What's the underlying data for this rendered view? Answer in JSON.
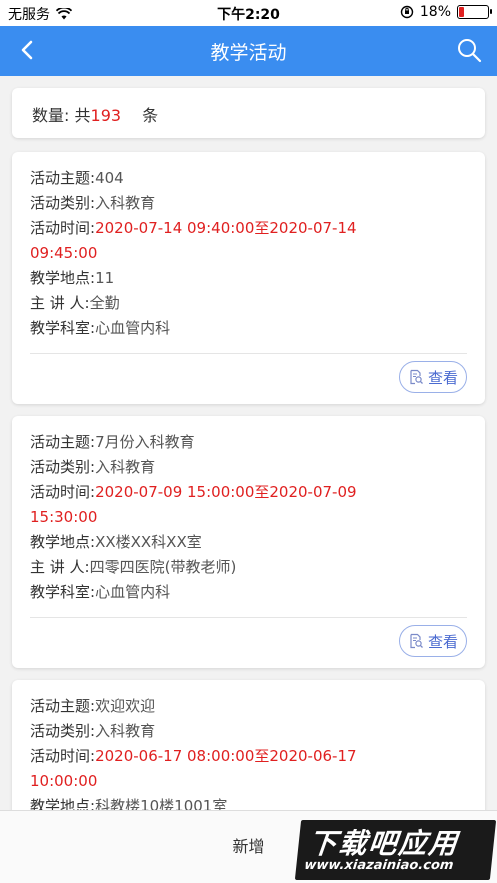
{
  "status_bar": {
    "carrier": "无服务",
    "time": "下午2:20",
    "battery_percent": "18%",
    "battery_level": 0.18
  },
  "nav": {
    "title": "教学活动",
    "back_icon": "chevron-left-icon",
    "search_icon": "search-icon"
  },
  "summary": {
    "label": "数量:",
    "prefix": "共",
    "count": "193",
    "suffix": "条"
  },
  "labels": {
    "topic": "活动主题:",
    "category": "活动类别:",
    "time": "活动时间:",
    "location": "教学地点:",
    "speaker": "主 讲 人:",
    "department": "教学科室:"
  },
  "view_button": "查看",
  "activities": [
    {
      "topic": "404",
      "category": "入科教育",
      "time_line1": "2020-07-14 09:40:00至2020-07-14",
      "time_line2": "09:45:00",
      "location": "11",
      "speaker": "全勤",
      "department": "心血管内科"
    },
    {
      "topic": "7月份入科教育",
      "category": "入科教育",
      "time_line1": "2020-07-09 15:00:00至2020-07-09",
      "time_line2": "15:30:00",
      "location": "XX楼XX科XX室",
      "speaker": "四零四医院(带教老师)",
      "department": "心血管内科"
    },
    {
      "topic": "欢迎欢迎",
      "category": "入科教育",
      "time_line1": "2020-06-17 08:00:00至2020-06-17",
      "time_line2": "10:00:00",
      "location": "科教楼10楼1001室"
    }
  ],
  "bottom": {
    "add_label": "新增"
  },
  "watermark": {
    "line1": "下载吧应用",
    "line2": "www.xiazainiao.com"
  },
  "colors": {
    "primary": "#3a8df0",
    "accent_red": "#e02020",
    "button_border": "#9ab0e8"
  }
}
